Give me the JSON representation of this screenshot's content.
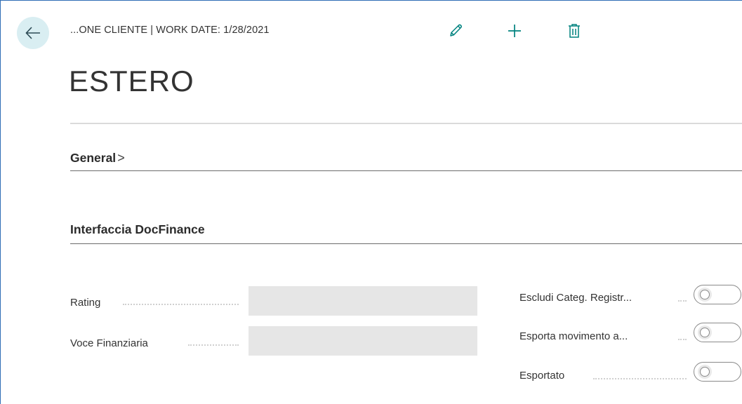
{
  "header": {
    "breadcrumb": "...ONE CLIENTE | WORK DATE: 1/28/2021",
    "title": "ESTERO",
    "actions": {
      "edit_icon": "pencil-icon",
      "new_icon": "plus-icon",
      "delete_icon": "trash-icon",
      "back_icon": "arrow-left-icon"
    }
  },
  "sections": {
    "general": {
      "label": "General",
      "chevron": ">"
    },
    "docfinance": {
      "label": "Interfaccia DocFinance",
      "left_fields": [
        {
          "label": "Rating",
          "value": ""
        },
        {
          "label": "Voce Finanziaria",
          "value": ""
        }
      ],
      "right_fields": [
        {
          "label": "Escludi Categ. Registr...",
          "checked": false
        },
        {
          "label": "Esporta movimento a...",
          "checked": false
        },
        {
          "label": "Esportato",
          "checked": false
        }
      ]
    }
  },
  "colors": {
    "accent": "#00827f",
    "back_button_bg": "#d9eef2",
    "input_bg": "#e6e6e6"
  }
}
